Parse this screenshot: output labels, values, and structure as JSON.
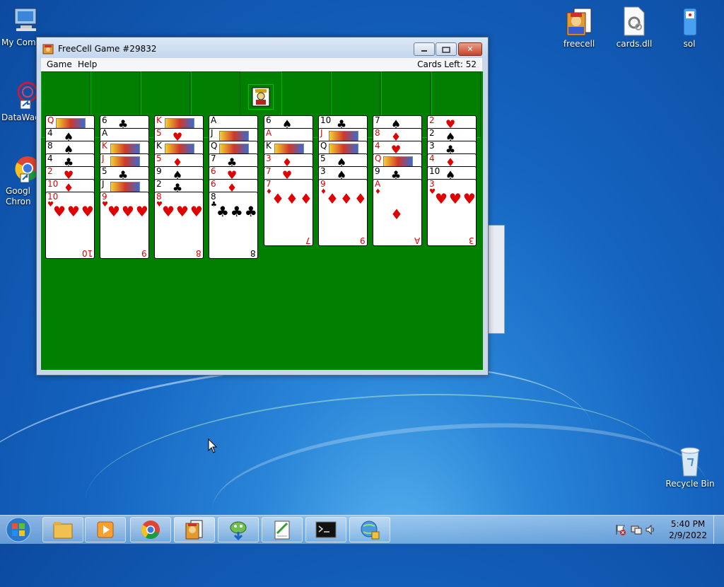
{
  "desktop_icons": {
    "my_computer": "My Comp",
    "datawag": "DataWag",
    "chrome": "Googl Chron",
    "freecell": "freecell",
    "cards_dll": "cards.dll",
    "sol": "sol",
    "recycle_bin": "Recycle Bin"
  },
  "window": {
    "title": "FreeCell Game #29832",
    "menu_game": "Game",
    "menu_help": "Help",
    "cards_left": "Cards Left: 52"
  },
  "cascades": [
    [
      {
        "r": "Q",
        "s": "♥"
      },
      {
        "r": "4",
        "s": "♠"
      },
      {
        "r": "8",
        "s": "♠"
      },
      {
        "r": "4",
        "s": "♣"
      },
      {
        "r": "2",
        "s": "♥"
      },
      {
        "r": "10",
        "s": "♦"
      },
      {
        "r": "10",
        "s": "♥"
      }
    ],
    [
      {
        "r": "6",
        "s": "♣"
      },
      {
        "r": "A",
        "s": "♠"
      },
      {
        "r": "K",
        "s": "♥"
      },
      {
        "r": "J",
        "s": "♥"
      },
      {
        "r": "5",
        "s": "♣"
      },
      {
        "r": "J",
        "s": "♠"
      },
      {
        "r": "9",
        "s": "♥"
      }
    ],
    [
      {
        "r": "K",
        "s": "♦"
      },
      {
        "r": "5",
        "s": "♥"
      },
      {
        "r": "K",
        "s": "♠"
      },
      {
        "r": "5",
        "s": "♦"
      },
      {
        "r": "9",
        "s": "♠"
      },
      {
        "r": "2",
        "s": "♣"
      },
      {
        "r": "8",
        "s": "♥"
      }
    ],
    [
      {
        "r": "A",
        "s": "♣"
      },
      {
        "r": "J",
        "s": "♣"
      },
      {
        "r": "Q",
        "s": "♠"
      },
      {
        "r": "7",
        "s": "♣"
      },
      {
        "r": "6",
        "s": "♥"
      },
      {
        "r": "6",
        "s": "♦"
      },
      {
        "r": "8",
        "s": "♣"
      }
    ],
    [
      {
        "r": "6",
        "s": "♠"
      },
      {
        "r": "A",
        "s": "♥"
      },
      {
        "r": "K",
        "s": "♣"
      },
      {
        "r": "3",
        "s": "♦"
      },
      {
        "r": "7",
        "s": "♥"
      },
      {
        "r": "7",
        "s": "♦"
      }
    ],
    [
      {
        "r": "10",
        "s": "♣"
      },
      {
        "r": "J",
        "s": "♦"
      },
      {
        "r": "Q",
        "s": "♣"
      },
      {
        "r": "5",
        "s": "♠"
      },
      {
        "r": "3",
        "s": "♠"
      },
      {
        "r": "9",
        "s": "♦"
      }
    ],
    [
      {
        "r": "7",
        "s": "♠"
      },
      {
        "r": "8",
        "s": "♦"
      },
      {
        "r": "4",
        "s": "♥"
      },
      {
        "r": "Q",
        "s": "♦"
      },
      {
        "r": "9",
        "s": "♣"
      },
      {
        "r": "A",
        "s": "♦"
      }
    ],
    [
      {
        "r": "2",
        "s": "♥"
      },
      {
        "r": "2",
        "s": "♠"
      },
      {
        "r": "3",
        "s": "♣"
      },
      {
        "r": "4",
        "s": "♦"
      },
      {
        "r": "10",
        "s": "♠"
      },
      {
        "r": "3",
        "s": "♥"
      }
    ]
  ],
  "taskbar": {
    "clock_time": "5:40 PM",
    "clock_date": "2/9/2022"
  },
  "colors": {
    "felt": "#007f00",
    "red_suit": "#e00000"
  }
}
